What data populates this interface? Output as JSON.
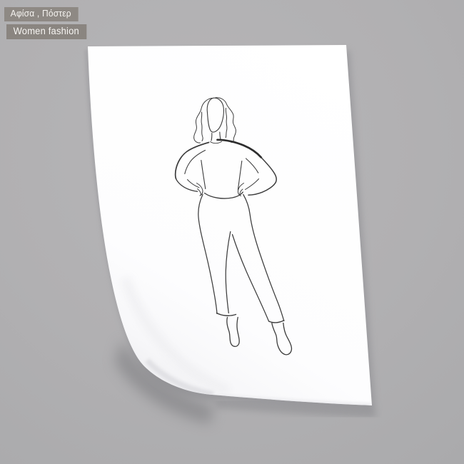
{
  "scene": {
    "background_color": "#b1b0b2",
    "paper_color": "#ffffff",
    "shadow_color": "#85858a",
    "artwork": {
      "name": "woman-fashion-line-drawing",
      "stroke_color": "#2d2d2d"
    }
  },
  "tags": {
    "primary": {
      "text": "Αφίσα , Πόστερ",
      "background": "#8e8984",
      "text_color": "#f7f5f2"
    },
    "secondary": {
      "text": "Women fashion",
      "background": "#8a8580",
      "text_color": "#f7f5f2"
    }
  }
}
